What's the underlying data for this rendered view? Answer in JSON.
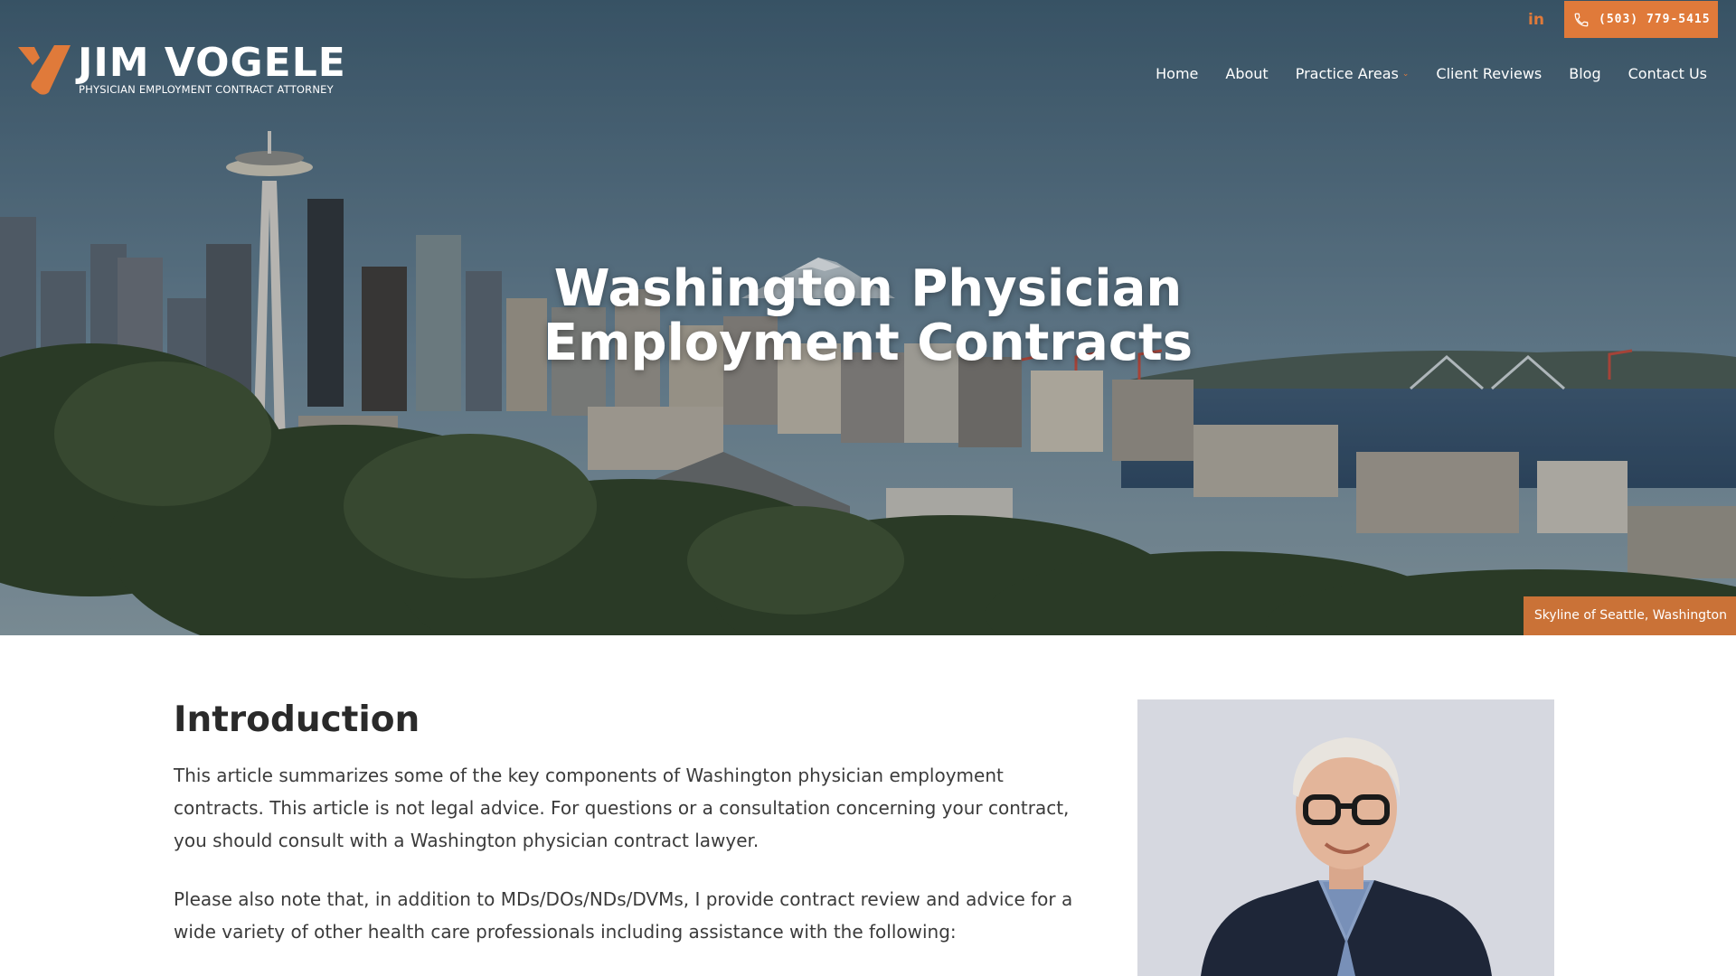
{
  "brand": {
    "name": "JIM VOGELE",
    "tagline": "PHYSICIAN EMPLOYMENT CONTRACT ATTORNEY"
  },
  "topbar": {
    "linkedin_label": "in",
    "phone": "(503) 779-5415"
  },
  "nav": {
    "items": [
      {
        "label": "Home"
      },
      {
        "label": "About"
      },
      {
        "label": "Practice Areas",
        "has_dropdown": true
      },
      {
        "label": "Client Reviews"
      },
      {
        "label": "Blog"
      },
      {
        "label": "Contact Us"
      }
    ]
  },
  "hero": {
    "title_line1": "Washington Physician",
    "title_line2": "Employment Contracts",
    "caption": "Skyline of Seattle, Washington"
  },
  "content": {
    "heading": "Introduction",
    "paragraph1": "This article summarizes some of the key components of Washington physician employment contracts.  This article is not legal advice.  For questions or a consultation concerning your contract, you should consult with a Washington physician contract lawyer.",
    "paragraph2": "Please also note that, in addition to MDs/DOs/NDs/DVMs, I provide contract review and advice for a wide variety of other health care professionals including assistance with the following:"
  },
  "colors": {
    "accent": "#e07a3a",
    "text": "#3b3b3b",
    "heading": "#2a2a2a"
  }
}
